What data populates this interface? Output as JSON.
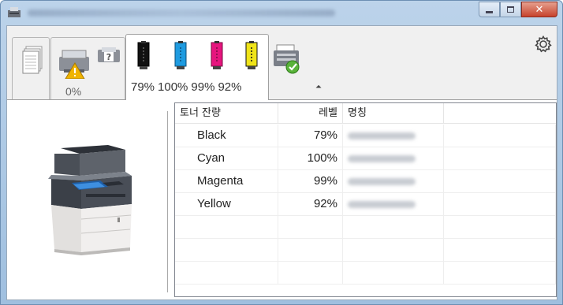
{
  "window": {
    "title": ""
  },
  "tabs": {
    "status": {
      "percent": "0%"
    },
    "toner": {
      "levels": [
        {
          "name": "Black",
          "label": "79%",
          "level": 79,
          "color": "#111111"
        },
        {
          "name": "Cyan",
          "label": "100%",
          "level": 100,
          "color": "#1e9be0"
        },
        {
          "name": "Magenta",
          "label": "99%",
          "level": 99,
          "color": "#e6157e"
        },
        {
          "name": "Yellow",
          "label": "92%",
          "level": 92,
          "color": "#f0e419"
        }
      ]
    }
  },
  "table": {
    "headers": {
      "toner": "토너 잔량",
      "level": "레벨",
      "name": "명칭"
    },
    "rows": [
      {
        "toner": "Black",
        "level": "79%"
      },
      {
        "toner": "Cyan",
        "level": "100%"
      },
      {
        "toner": "Magenta",
        "level": "99%"
      },
      {
        "toner": "Yellow",
        "level": "92%"
      }
    ]
  },
  "colors": {
    "accent": "#1e9be0",
    "warning": "#f0b400",
    "ok_check": "#59b33a",
    "close_button": "#c7422c"
  },
  "icons": [
    "app-icon",
    "documents-icon",
    "warning-printer-icon",
    "question-icon",
    "toner-cartridge-icon",
    "scan-check-icon",
    "caret-up-icon",
    "gear-icon",
    "printer-image"
  ]
}
